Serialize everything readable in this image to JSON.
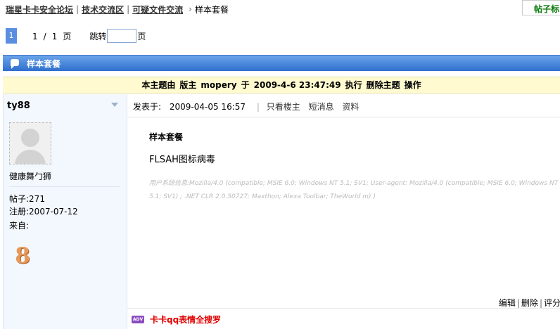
{
  "breadcrumb": {
    "items": [
      "瑞星卡卡安全论坛",
      "技术交流区",
      "可疑文件交流"
    ],
    "current": "样本套餐",
    "separator": "|",
    "arrow": "›"
  },
  "top_right_tab": "帖子标",
  "pager": {
    "current_page": "1",
    "page_info": [
      "1",
      "/",
      "1",
      "页"
    ],
    "jump_label": "跳转",
    "jump_value": "",
    "jump_suffix": "页"
  },
  "section": {
    "title": "样本套餐"
  },
  "notice": {
    "parts": [
      "本主题由",
      "版主",
      "mopery",
      "于",
      "2009-4-6 23:47:49",
      "执行",
      "删除主题",
      "操作"
    ]
  },
  "author": {
    "name": "ty88",
    "rank": "健康舞勹狮",
    "posts_label": "帖子:",
    "posts": "271",
    "reg_label": "注册:",
    "reg_date": "2007-07-12",
    "from_label": "来自:",
    "level": "8"
  },
  "post": {
    "time_label": "发表于:",
    "time": "2009-04-05 16:57",
    "links": [
      "只看楼主",
      "短消息",
      "资料"
    ],
    "title": "样本套餐",
    "body": "FLSAH图标病毒",
    "sysinfo": "用户系统信息:Mozilla/4.0 (compatible; MSIE 6.0; Windows NT 5.1; SV1; User-agent: Mozilla/4.0 (compatible; MSIE 6.0; Windows NT 5.1; SV1) ; .NET CLR 2.0.50727; Maxthon; Alexa Toolbar; TheWorld m) )",
    "actions": [
      "编辑",
      "删除",
      "评分"
    ],
    "ad_icon": "ADV",
    "ad_text": "卡卡qq表情全搜罗"
  },
  "colors": {
    "section_bar": "#3f7fd8",
    "notice_bg": "#fffad0",
    "author_bg": "#f3f8ff",
    "ad_text": "#e00000",
    "tab_text": "#0a7a0a"
  }
}
